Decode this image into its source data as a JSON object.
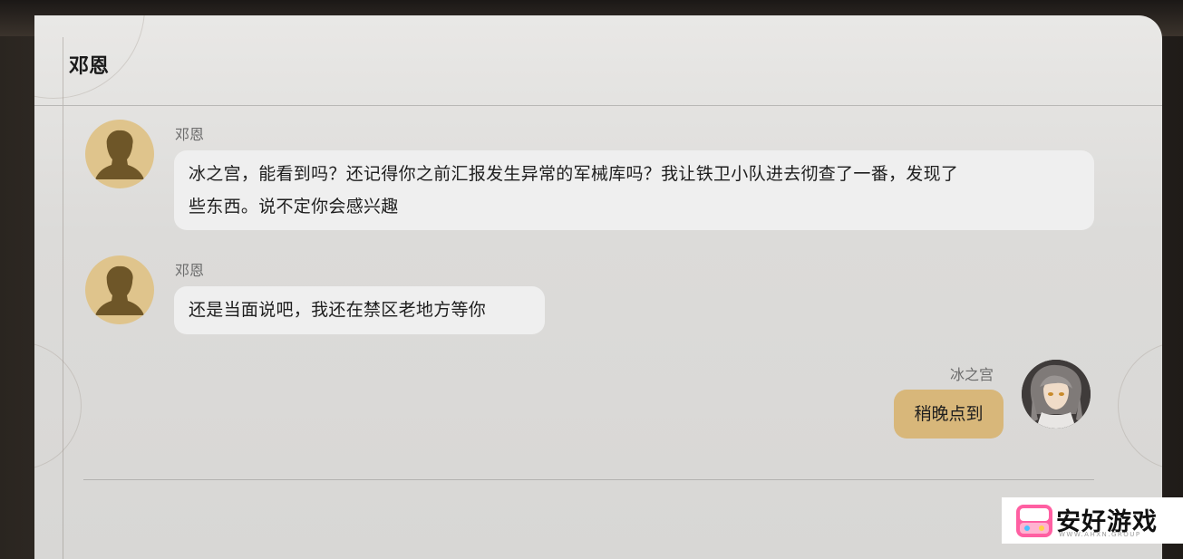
{
  "header": {
    "title": "邓恩"
  },
  "messages": [
    {
      "sender": "邓恩",
      "avatar_icon": "silhouette-icon",
      "text_line1": "冰之宫，能看到吗？还记得你之前汇报发生异常的军械库吗？我让铁卫小队进去彻查了一番，发现了",
      "text_line2": "些东西。说不定你会感兴趣"
    },
    {
      "sender": "邓恩",
      "avatar_icon": "silhouette-icon",
      "text": "还是当面说吧，我还在禁区老地方等你"
    },
    {
      "sender": "冰之宫",
      "avatar_icon": "character-portrait-icon",
      "text": "稍晚点到"
    }
  ],
  "watermark": {
    "brand": "安好游戏",
    "sub": "WWW.AHXN.GROUP"
  },
  "colors": {
    "self_bubble": "#d8b77a",
    "other_bubble": "#efefef",
    "avatar_gold": "#dfc48c"
  }
}
